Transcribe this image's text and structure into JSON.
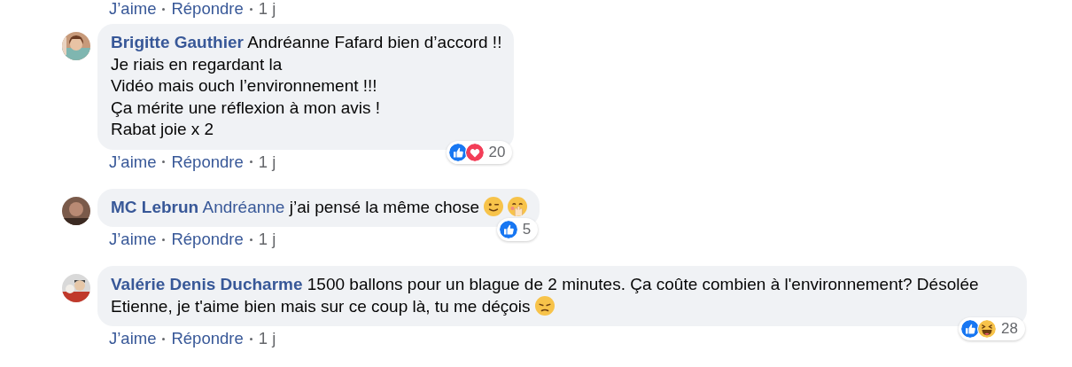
{
  "previous_actions": {
    "like": "J’aime",
    "reply": "Répondre",
    "time": "1 j"
  },
  "comments": [
    {
      "author": "Brigitte Gauthier",
      "text": "Andréanne Fafard bien d’accord !!\nJe riais en regardant la\nVidéo mais ouch l’environnement !!!\nÇa mérite une réflexion à mon avis !\nRabat joie x 2",
      "reactions": [
        {
          "kind": "like"
        },
        {
          "kind": "love"
        }
      ],
      "reaction_count": "20",
      "actions": {
        "like": "J’aime",
        "reply": "Répondre",
        "time": "1 j"
      }
    },
    {
      "author": "MC Lebrun",
      "mention": "Andréanne",
      "text": "j’ai pensé la même chose",
      "emojis": [
        {
          "kind": "wink"
        },
        {
          "kind": "hand-over-mouth"
        }
      ],
      "reactions": [
        {
          "kind": "like"
        }
      ],
      "reaction_count": "5",
      "actions": {
        "like": "J’aime",
        "reply": "Répondre",
        "time": "1 j"
      }
    },
    {
      "author": "Valérie Denis Ducharme",
      "text": "1500 ballons pour un blague de 2 minutes. Ça coûte combien à l'environnement? Désolée Etienne, je t'aime bien mais sur ce coup là, tu me déçois",
      "emojis": [
        {
          "kind": "disappointed"
        }
      ],
      "reactions": [
        {
          "kind": "like"
        },
        {
          "kind": "haha"
        }
      ],
      "reaction_count": "28",
      "actions": {
        "like": "J’aime",
        "reply": "Répondre",
        "time": "1 j"
      }
    }
  ]
}
